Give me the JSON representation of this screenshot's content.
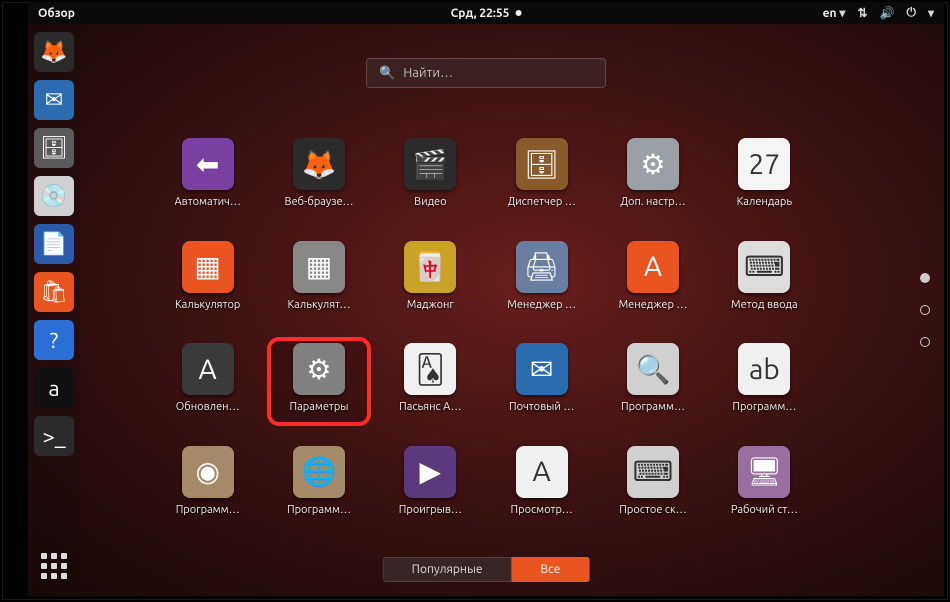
{
  "topbar": {
    "overview": "Обзор",
    "clock": "Срд, 22:55",
    "lang": "en"
  },
  "search": {
    "placeholder": "Найти…"
  },
  "dock": [
    {
      "name": "firefox",
      "glyph": "🦊",
      "bg": "#2b2b2b"
    },
    {
      "name": "thunderbird",
      "glyph": "✉",
      "bg": "#2b6cb0"
    },
    {
      "name": "files",
      "glyph": "🗄",
      "bg": "#5a5a5a"
    },
    {
      "name": "rhythmbox",
      "glyph": "💿",
      "bg": "#d0d0d0"
    },
    {
      "name": "writer",
      "glyph": "📄",
      "bg": "#2e5aac"
    },
    {
      "name": "software",
      "glyph": "🛍",
      "bg": "#e95420"
    },
    {
      "name": "help",
      "glyph": "?",
      "bg": "#2a6fd6"
    },
    {
      "name": "amazon",
      "glyph": "a",
      "bg": "#111111"
    },
    {
      "name": "terminal",
      "glyph": ">_",
      "bg": "#2b2b2b"
    }
  ],
  "apps": [
    {
      "label": "Автоматич…",
      "name": "backups",
      "glyph": "⬅",
      "bg": "#7a3fa0"
    },
    {
      "label": "Веб-браузе…",
      "name": "firefox",
      "glyph": "🦊",
      "bg": "#2b2b2b"
    },
    {
      "label": "Видео",
      "name": "videos",
      "glyph": "🎬",
      "bg": "#2b2b2b"
    },
    {
      "label": "Диспетчер …",
      "name": "archive-manager",
      "glyph": "🗄",
      "bg": "#8a5a2b"
    },
    {
      "label": "Доп. настр…",
      "name": "tweaks",
      "glyph": "⚙",
      "bg": "#9aa0a6"
    },
    {
      "label": "Календарь",
      "name": "calendar",
      "glyph": "27",
      "bg": "#f5f5f5"
    },
    {
      "label": "Калькулятор",
      "name": "calculator",
      "glyph": "▦",
      "bg": "#e95420"
    },
    {
      "label": "Калькулят…",
      "name": "calc",
      "glyph": "▦",
      "bg": "#888888"
    },
    {
      "label": "Маджонг",
      "name": "mahjongg",
      "glyph": "🀄",
      "bg": "#c9a227"
    },
    {
      "label": "Менеджер …",
      "name": "print-manager",
      "glyph": "🖨",
      "bg": "#6a7fa0"
    },
    {
      "label": "Менеджер …",
      "name": "software-center",
      "glyph": "A",
      "bg": "#e95420"
    },
    {
      "label": "Метод ввода",
      "name": "input-method",
      "glyph": "⌨",
      "bg": "#dddddd"
    },
    {
      "label": "Обновлен…",
      "name": "software-updater",
      "glyph": "A",
      "bg": "#3a3a3a"
    },
    {
      "label": "Параметры",
      "name": "settings",
      "glyph": "⚙",
      "bg": "#808080",
      "highlight": true
    },
    {
      "label": "Пасьянс А…",
      "name": "aisleriot",
      "glyph": "🂡",
      "bg": "#f0f0f0"
    },
    {
      "label": "Почтовый …",
      "name": "thunderbird",
      "glyph": "✉",
      "bg": "#2b6cb0"
    },
    {
      "label": "Программ…",
      "name": "image-viewer",
      "glyph": "🔍",
      "bg": "#d0d0d0"
    },
    {
      "label": "Программ…",
      "name": "fonts",
      "glyph": "ab",
      "bg": "#f0f0f0"
    },
    {
      "label": "Программ…",
      "name": "software-sources",
      "glyph": "◉",
      "bg": "#a58a6a"
    },
    {
      "label": "Программ…",
      "name": "app-store",
      "glyph": "🌐",
      "bg": "#a58a6a"
    },
    {
      "label": "Проигрыв…",
      "name": "player",
      "glyph": "▶",
      "bg": "#5a3a7d"
    },
    {
      "label": "Просмотр…",
      "name": "document-viewer",
      "glyph": "A",
      "bg": "#f0f0f0"
    },
    {
      "label": "Простое ск…",
      "name": "simple-scan",
      "glyph": "⌨",
      "bg": "#d0d0d0"
    },
    {
      "label": "Рабочий ст…",
      "name": "remote-desktop",
      "glyph": "🖥",
      "bg": "#9a6fa0"
    }
  ],
  "tabs": {
    "frequent": "Популярные",
    "all": "Все",
    "active": "all"
  },
  "pager": {
    "count": 3,
    "active": 0
  },
  "colors": {
    "accent": "#e95420"
  }
}
